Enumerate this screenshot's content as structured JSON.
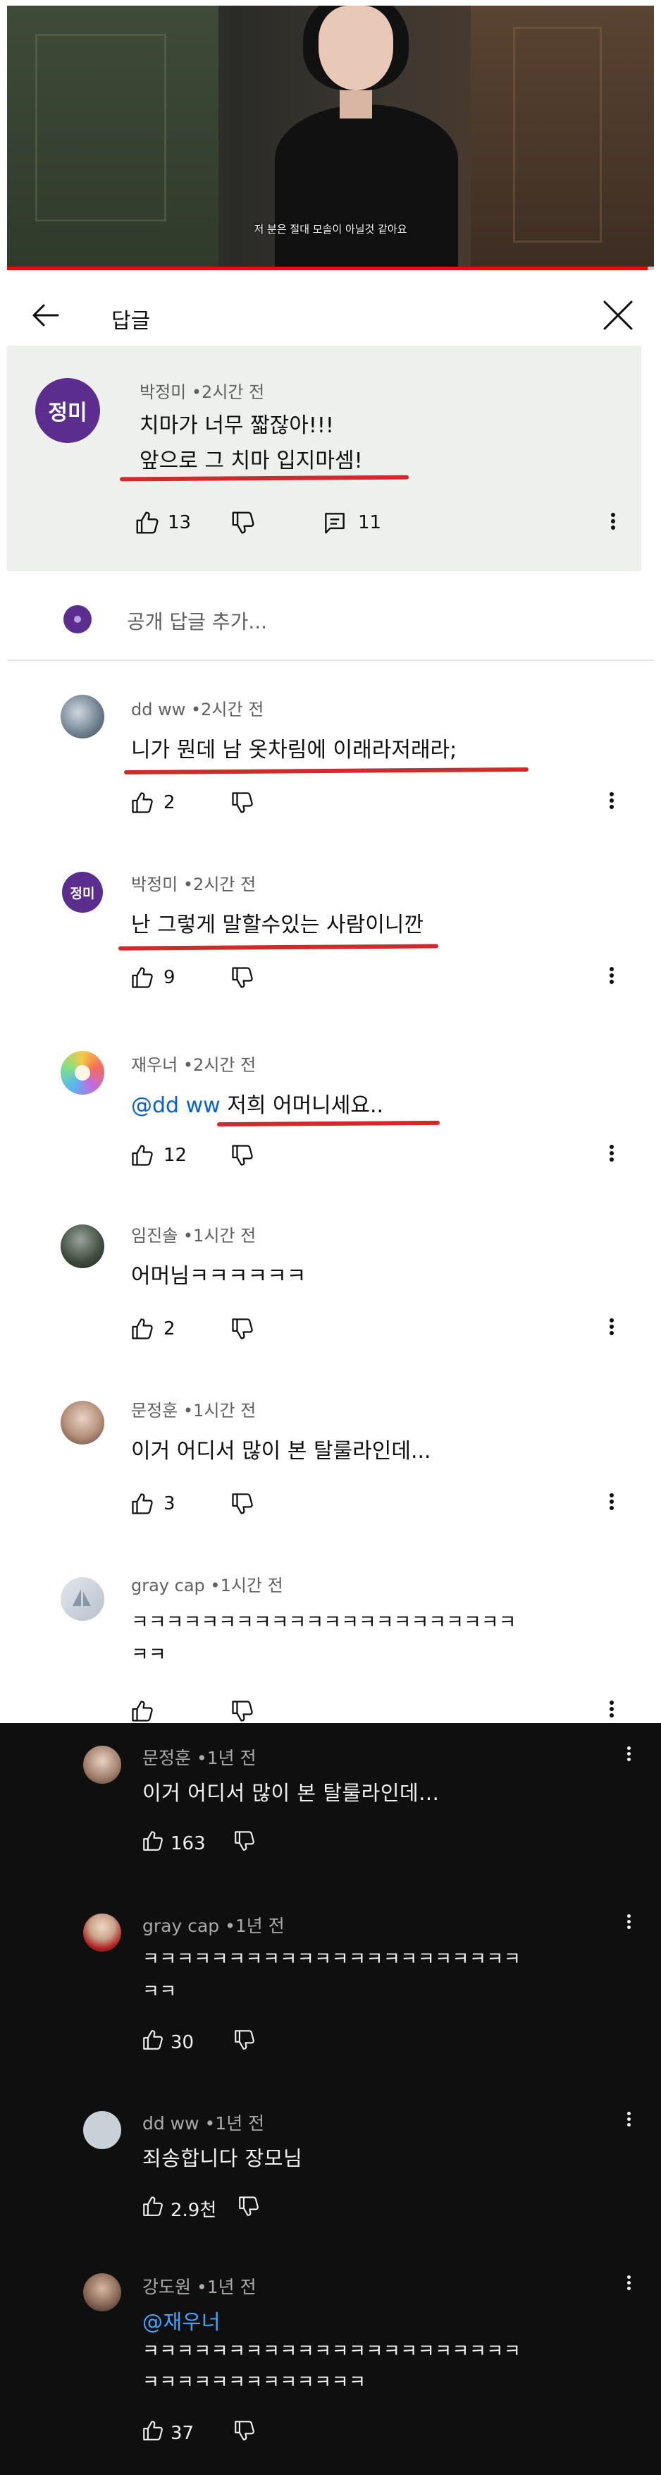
{
  "video": {
    "caption": "저 분은 절대 모솔이 아닐것 같아요",
    "progress_fraction": 0.99
  },
  "header": {
    "title": "답글"
  },
  "parent_comment": {
    "avatar_text": "정미",
    "avatar_color": "#5b2d8e",
    "author": "박정미",
    "time": "2시간 전",
    "line1": "치마가 너무 짧잖아!!!",
    "line2": "앞으로 그 치마 입지마셈!",
    "likes": "13",
    "replies": "11"
  },
  "add_reply": {
    "placeholder": "공개 답글 추가..."
  },
  "replies": [
    {
      "author": "dd ww",
      "time": "2시간 전",
      "text": "니가 뭔데 남 옷차림에 이래라저래라;",
      "likes": "2"
    },
    {
      "author": "박정미",
      "time": "2시간 전",
      "avatar_text": "정미",
      "text": "난 그렇게 말할수있는 사람이니깐",
      "likes": "9"
    },
    {
      "author": "재우너",
      "time": "2시간 전",
      "mention": "@dd ww",
      "text": "저희 어머니세요..",
      "likes": "12"
    },
    {
      "author": "임진솔",
      "time": "1시간 전",
      "text": "어머님ㅋㅋㅋㅋㅋㅋ",
      "likes": "2"
    },
    {
      "author": "문정훈",
      "time": "1시간 전",
      "text": "이거 어디서 많이 본 탈룰라인데...",
      "likes": "3"
    },
    {
      "author": "gray cap",
      "time": "1시간 전",
      "line1": "ㅋㅋㅋㅋㅋㅋㅋㅋㅋㅋㅋㅋㅋㅋㅋㅋㅋㅋㅋㅋㅋㅋ",
      "line2": "ㅋㅋ"
    }
  ],
  "dark_comments": [
    {
      "author": "문정훈",
      "time": "1년 전",
      "text": "이거 어디서 많이 본 탈룰라인데...",
      "likes": "163"
    },
    {
      "author": "gray cap",
      "time": "1년 전",
      "line1": "ㅋㅋㅋㅋㅋㅋㅋㅋㅋㅋㅋㅋㅋㅋㅋㅋㅋㅋㅋㅋㅋㅋ",
      "line2": "ㅋㅋ",
      "likes": "30"
    },
    {
      "author": "dd ww",
      "time": "1년 전",
      "text": "죄송합니다 장모님",
      "likes": "2.9천"
    },
    {
      "author": "강도원",
      "time": "1년 전",
      "mention": "@재우너",
      "line1": "ㅋㅋㅋㅋㅋㅋㅋㅋㅋㅋㅋㅋㅋㅋㅋㅋㅋㅋㅋㅋㅋㅋ",
      "line2": "ㅋㅋㅋㅋㅋㅋㅋㅋㅋㅋㅋㅋㅋ",
      "likes": "37"
    }
  ],
  "meta_separator": "•",
  "colors": {
    "underline": "#d02a2a",
    "dark_bg": "#0f0f0f",
    "mention_light": "#065fd4",
    "mention_dark": "#3ea6ff",
    "add_reply_avatar": "#5b2d8e"
  }
}
